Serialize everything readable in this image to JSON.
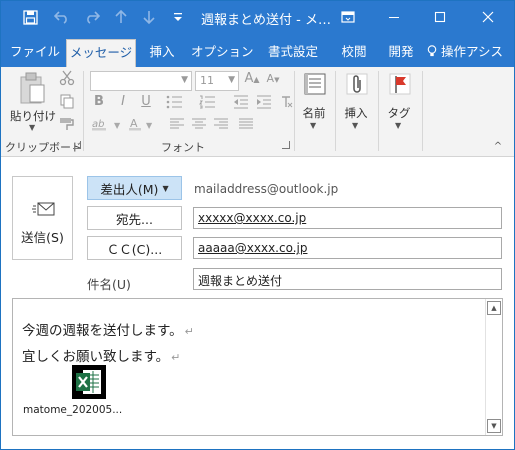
{
  "window": {
    "title": "週報まとめ送付 - メ…"
  },
  "quick_access": {
    "save_icon": "save-icon",
    "undo_icon": "undo-icon",
    "redo_icon": "redo-icon",
    "up_icon": "arrow-up-icon",
    "down_icon": "arrow-down-icon",
    "customize_icon": "customize-qat-icon"
  },
  "tabs": [
    {
      "label": "ファイル"
    },
    {
      "label": "メッセージ"
    },
    {
      "label": "挿入"
    },
    {
      "label": "オプション"
    },
    {
      "label": "書式設定"
    },
    {
      "label": "校閲"
    },
    {
      "label": "開発"
    },
    {
      "label": "操作アシス"
    }
  ],
  "ribbon": {
    "clipboard": {
      "paste_label": "貼り付け",
      "group_label": "クリップボード"
    },
    "font": {
      "font_name": "",
      "font_size": "11",
      "group_label": "フォント",
      "bold": "B",
      "italic": "I",
      "underline": "U"
    },
    "names": {
      "label": "名前"
    },
    "insert": {
      "label": "挿入"
    },
    "tags": {
      "label": "タグ"
    }
  },
  "compose": {
    "send_label": "送信(S)",
    "from_button": "差出人(M)",
    "from_address": "mailaddress@outlook.jp",
    "to_button": "宛先...",
    "to_value": "xxxxx@xxxx.co.jp",
    "cc_button": "ＣＣ(C)...",
    "cc_value": "aaaaa@xxxx.co.jp",
    "subject_label": "件名(U)",
    "subject_value": "週報まとめ送付"
  },
  "body": {
    "lines": [
      "今週の週報を送付します。",
      "宜しくお願い致します。"
    ],
    "paragraph_mark": "↵",
    "attachment": {
      "filename": "matome_202005...",
      "icon": "excel-file-icon"
    }
  },
  "colors": {
    "accent": "#2b79cf",
    "from_button_bg": "#cce3f7",
    "excel_green": "#1e7145"
  }
}
